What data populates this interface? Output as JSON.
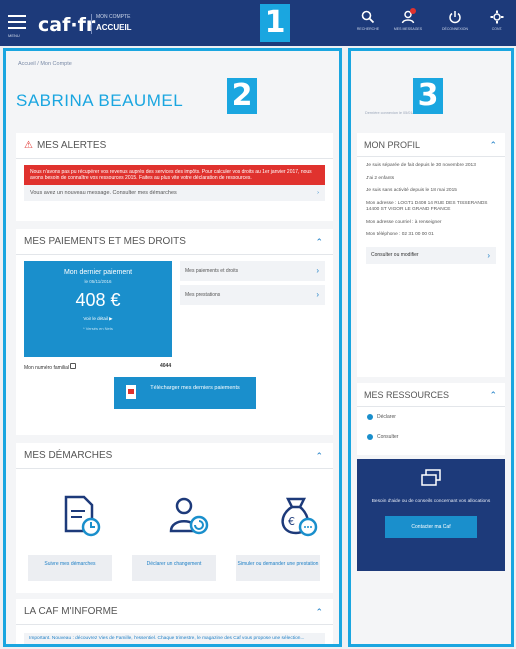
{
  "header": {
    "menu_label": "MENU",
    "logo": "caf·fr",
    "account_small": "MON COMPTE",
    "account_big": "ACCUEIL",
    "tools": [
      {
        "icon": "search-icon",
        "label": "RECHERCHE"
      },
      {
        "icon": "messages-icon",
        "label": "MES MESSAGES"
      },
      {
        "icon": "power-icon",
        "label": "DÉCONNEXION"
      },
      {
        "icon": "settings-icon",
        "label": "CONT."
      }
    ]
  },
  "badges": {
    "one": "1",
    "two": "2",
    "three": "3"
  },
  "left": {
    "breadcrumb": "Accueil  /  Mon Compte",
    "user_name": "SABRINA BEAUMEL",
    "alerts": {
      "title": "MES ALERTES",
      "red_text": "Nous n'avons pas pu récupérer vos revenus auprès des services des impôts. Pour calculer vos droits au 1er janvier 2017, nous avons besoin de connaître vos ressources 2015. Faites au plus vite votre déclaration de ressources.",
      "message_row": "Vous avez un nouveau message. Consulter mes démarches"
    },
    "payments": {
      "title": "MES PAIEMENTS ET MES DROITS",
      "box_title": "Mon dernier paiement",
      "box_date": "le 05/11/2016",
      "amount": "408 €",
      "detail_link": "Voir le détail ▶",
      "note": "* Versés en Nets",
      "links": [
        "Mes paiements et droits",
        "Mes prestations"
      ],
      "allocataire_label": "Mon numéro familial",
      "allocataire_number": "4044",
      "download_label": "Télécharger mes derniers paiements"
    },
    "demarches": {
      "title": "MES DÉMARCHES",
      "buttons": [
        "Suivre mes démarches",
        "Déclarer un changement",
        "Simuler ou demander une prestation"
      ]
    },
    "inform": {
      "title": "LA CAF M'INFORME",
      "text": "Important. Nouveau : découvrez Vies de Famille, l'essentiel. Chaque trimestre, le magazine des Caf vous propose une sélection..."
    }
  },
  "right": {
    "last_connection": "Dernière connexion le 05/01/2017 à 11:58",
    "profile": {
      "title": "MON PROFIL",
      "lines": [
        "Je suis séparée de fait depuis le 30 novembre 2013",
        "J'ai 2 enfants",
        "Je suis sans activité depuis le 18 mai 2015",
        "Mon adresse : LOGT1 D408 14 RUE DES TISSERANDS 14400 ST VIGOR LE GRAND FRANCE",
        "Mon adresse courriel : à renseigner",
        "Mon téléphone : 02 31 00 00 01"
      ],
      "modify_label": "Consulter ou modifier"
    },
    "ressources": {
      "title": "MES RESSOURCES",
      "items": [
        "Déclarer",
        "Consulter"
      ]
    },
    "help": {
      "text": "Besoin d'aide ou de conseils concernant vos allocations",
      "button": "Contacter ma Caf"
    }
  }
}
